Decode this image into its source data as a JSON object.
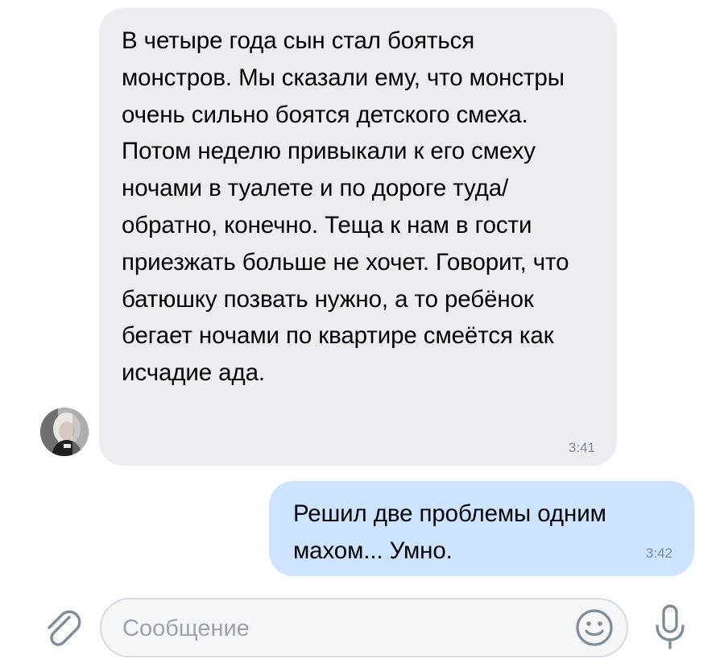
{
  "conversation": {
    "messages": [
      {
        "direction": "incoming",
        "text": "В четыре года сын стал бояться монстров. Мы сказали ему, что монстры очень сильно боятся детского смеха. Потом неделю привыкали к его смеху ночами в туалете и по дороге туда/обратно, конечно. Теща к нам в гости приезжать больше не хочет. Говорит, что батюшку позвать нужно, а то ребёнок бегает ночами по квартире смеётся как исчадие ада.",
        "time": "3:41"
      },
      {
        "direction": "outgoing",
        "text": "Решил две проблемы одним махом... Умно.",
        "time": "3:42"
      }
    ]
  },
  "composer": {
    "placeholder": "Сообщение",
    "value": "",
    "attach_icon": "paperclip-icon",
    "emoji_icon": "smile-icon",
    "voice_icon": "microphone-icon"
  },
  "colors": {
    "incoming_bubble": "#ebedf0",
    "outgoing_bubble": "#cce4ff",
    "icon": "#818c99",
    "time": "#7e8b99"
  }
}
